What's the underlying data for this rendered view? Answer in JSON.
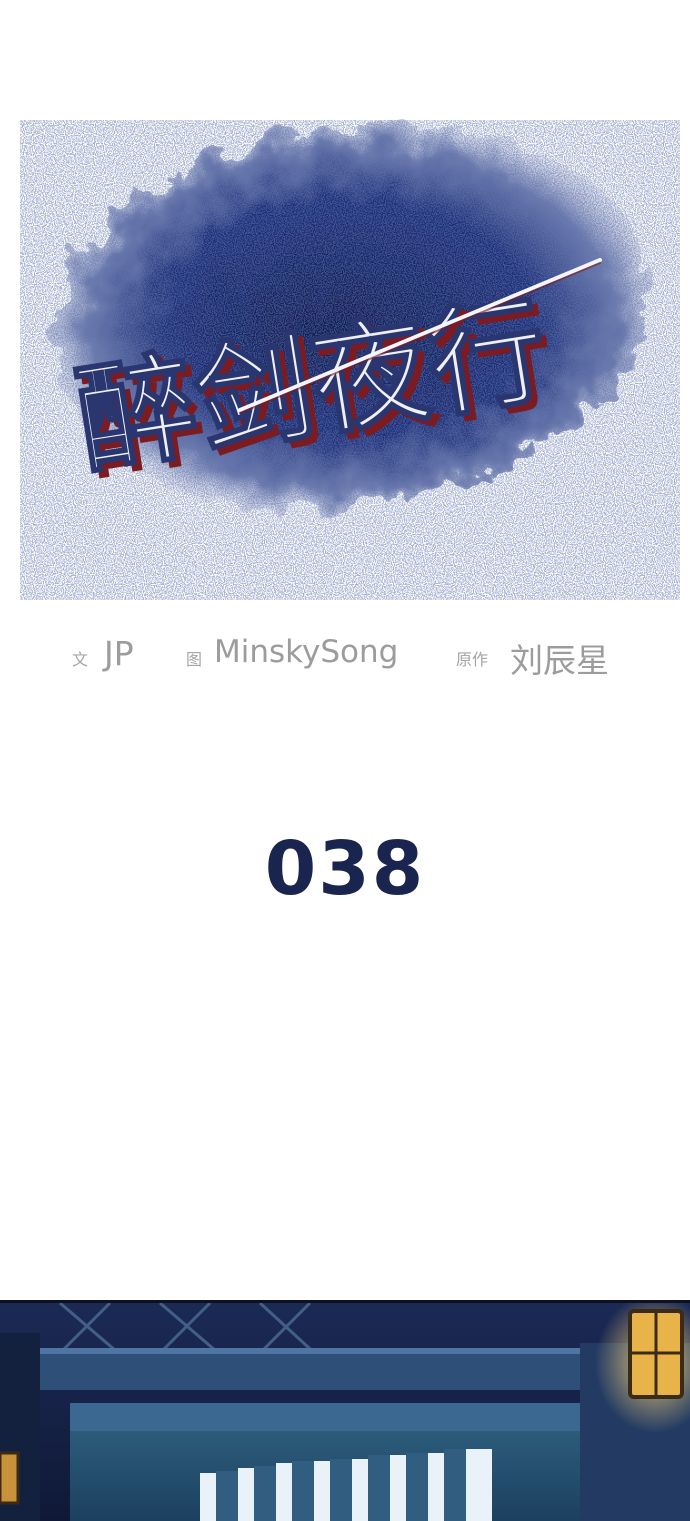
{
  "title": {
    "logo_text": "醉剑夜行"
  },
  "credits": {
    "writer_label": "文",
    "writer_name": "JP",
    "artist_label": "图",
    "artist_name": "MinskySong",
    "original_label": "原作",
    "original_name": "刘辰星"
  },
  "chapter": {
    "number": "038"
  },
  "colors": {
    "ink_blue": "#1e2d6b",
    "credit_gray": "#9c9c9c",
    "chapter_navy": "#19244f",
    "lantern_amber": "#e8b44a"
  }
}
